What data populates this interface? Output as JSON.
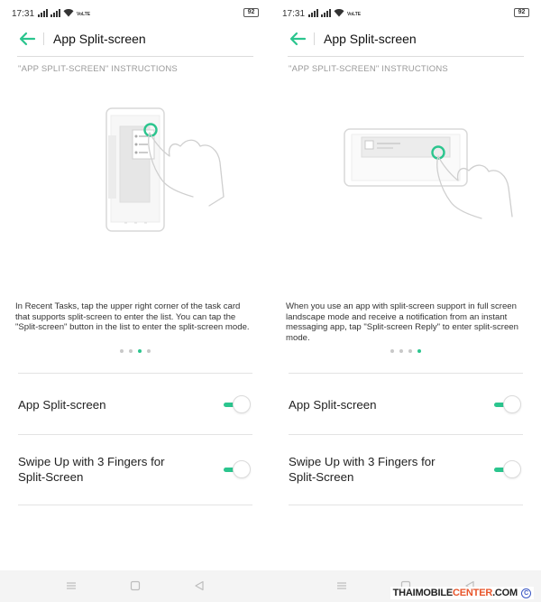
{
  "colors": {
    "accent": "#2bc58e",
    "divider": "#e3e3e3",
    "section_text": "#9a9a9a"
  },
  "panels": [
    {
      "status": {
        "time": "17:31",
        "network": "VoLTE",
        "battery": "92"
      },
      "appbar": {
        "title": "App Split-screen",
        "back_icon": "arrow-left-icon"
      },
      "section_header": "\"APP SPLIT-SCREEN\" INSTRUCTIONS",
      "illustration": "portrait-recent-tasks-tap",
      "description": "In Recent Tasks, tap the upper right corner of the task card that supports split-screen to enter the list. You can tap the \"Split-screen\" button in the list to enter the split-screen mode.",
      "pager": {
        "count": 4,
        "active_index": 2
      },
      "settings": [
        {
          "label": "App Split-screen",
          "enabled": true
        },
        {
          "label": "Swipe Up with 3 Fingers for Split-Screen",
          "enabled": true
        }
      ]
    },
    {
      "status": {
        "time": "17:31",
        "network": "VoLTE",
        "battery": "92"
      },
      "appbar": {
        "title": "App Split-screen",
        "back_icon": "arrow-left-icon"
      },
      "section_header": "\"APP SPLIT-SCREEN\" INSTRUCTIONS",
      "illustration": "landscape-notification-tap",
      "description": "When you use an app with split-screen support in full screen landscape mode and receive a notification from an instant messaging app, tap \"Split-screen Reply\" to enter split-screen mode.",
      "pager": {
        "count": 4,
        "active_index": 3
      },
      "settings": [
        {
          "label": "App Split-screen",
          "enabled": true
        },
        {
          "label": "Swipe Up with 3 Fingers for Split-Screen",
          "enabled": true
        }
      ]
    }
  ],
  "navbar": {
    "icons": [
      "menu-icon",
      "home-square-icon",
      "back-triangle-icon",
      "menu-icon",
      "home-square-icon",
      "back-triangle-icon"
    ]
  },
  "watermark": {
    "prefix": "THAIMOBILE",
    "accent": "CENTER",
    "suffix": ".COM",
    "mark": "C"
  }
}
